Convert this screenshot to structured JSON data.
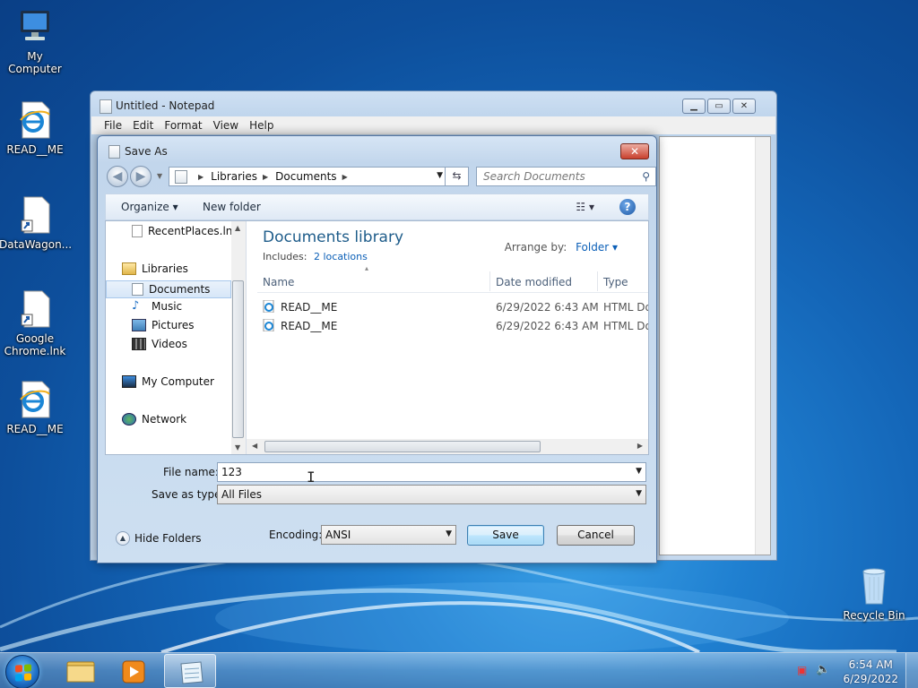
{
  "desktop": {
    "icons": [
      {
        "label": "My Computer"
      },
      {
        "label": "READ__ME"
      },
      {
        "label": "DataWagon..."
      },
      {
        "label": "Google Chrome.lnk"
      },
      {
        "label": "READ__ME"
      },
      {
        "label": "Recycle Bin"
      }
    ]
  },
  "notepad": {
    "title": "Untitled - Notepad",
    "menu": [
      "File",
      "Edit",
      "Format",
      "View",
      "Help"
    ]
  },
  "dialog": {
    "title": "Save As",
    "close_glyph": "✕",
    "breadcrumb": [
      "Libraries",
      "Documents"
    ],
    "search_placeholder": "Search Documents",
    "toolbar": {
      "organize": "Organize ▾",
      "new_folder": "New folder"
    },
    "nav": {
      "recent": "RecentPlaces.lnk",
      "libraries": "Libraries",
      "documents": "Documents",
      "music": "Music",
      "pictures": "Pictures",
      "videos": "Videos",
      "my_computer": "My Computer",
      "network": "Network"
    },
    "library": {
      "title": "Documents library",
      "includes_label": "Includes:",
      "includes_link": "2 locations",
      "arrange_label": "Arrange by:",
      "arrange_value": "Folder ▾"
    },
    "columns": [
      "Name",
      "Date modified",
      "Type"
    ],
    "files": [
      {
        "name": "READ__ME",
        "date": "6/29/2022 6:43 AM",
        "type": "HTML Do"
      },
      {
        "name": "READ__ME",
        "date": "6/29/2022 6:43 AM",
        "type": "HTML Do"
      }
    ],
    "form": {
      "file_name_label": "File name:",
      "file_name_value": "123",
      "save_type_label": "Save as type:",
      "save_type_value": "All Files",
      "encoding_label": "Encoding:",
      "encoding_value": "ANSI",
      "hide_folders": "Hide Folders",
      "save": "Save",
      "cancel": "Cancel"
    }
  },
  "taskbar": {
    "time": "6:54 AM",
    "date": "6/29/2022"
  },
  "colors": {
    "accent_link": "#0b5fb7",
    "library_title": "#1e5c8a",
    "close_red": "#c9412e"
  }
}
